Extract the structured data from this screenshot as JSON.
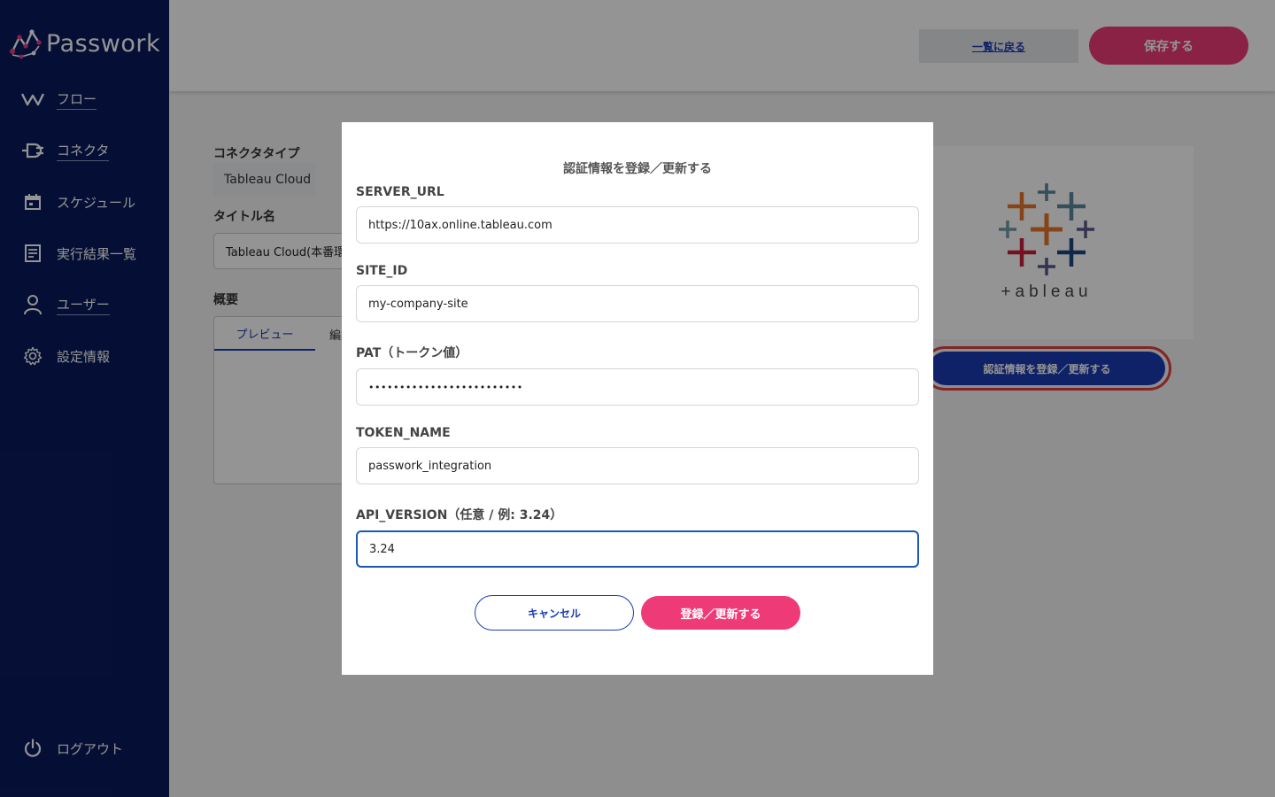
{
  "sidebar": {
    "brand": "Passwork",
    "items": [
      {
        "label": "フロー",
        "icon": "flow-icon"
      },
      {
        "label": "コネクタ",
        "icon": "plug-icon"
      },
      {
        "label": "スケジュール",
        "icon": "calendar-icon"
      },
      {
        "label": "実行結果一覧",
        "icon": "document-icon"
      },
      {
        "label": "ユーザー",
        "icon": "user-icon"
      },
      {
        "label": "設定情報",
        "icon": "gear-icon"
      }
    ],
    "logout": {
      "label": "ログアウト",
      "icon": "power-icon"
    }
  },
  "header": {
    "back_label": "一覧に戻る",
    "save_label": "保存する"
  },
  "form": {
    "connector_type_label": "コネクタタイプ",
    "connector_type_value": "Tableau Cloud",
    "title_label": "タイトル名",
    "title_value": "Tableau Cloud(本番環境)",
    "summary_label": "概要",
    "tab_preview": "プレビュー",
    "tab_edit": "編集",
    "auth_button_label": "認証情報を登録／更新する",
    "logo_text": "+ableau"
  },
  "modal": {
    "title": "認証情報を登録／更新する",
    "fields": [
      {
        "label": "SERVER_URL",
        "value": "https://10ax.online.tableau.com"
      },
      {
        "label": "SITE_ID",
        "value": "my-company-site"
      },
      {
        "label": "PAT（トークン値）",
        "value": "•••••••••••••••••••••••••"
      },
      {
        "label": "TOKEN_NAME",
        "value": "passwork_integration"
      },
      {
        "label": "API_VERSION（任意 / 例: 3.24）",
        "value": "3.24"
      }
    ],
    "cancel_label": "キャンセル",
    "submit_label": "登録／更新する"
  },
  "colors": {
    "sidebar_bg": "#0a1a5c",
    "primary": "#1b3bb3",
    "accent": "#ee3b77"
  }
}
